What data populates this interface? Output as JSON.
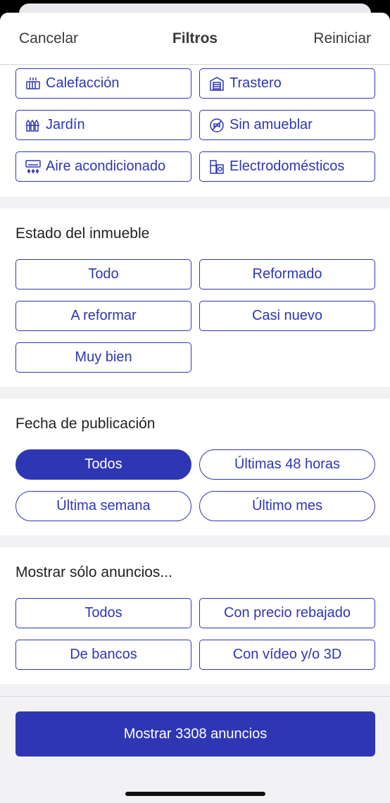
{
  "header": {
    "cancel": "Cancelar",
    "title": "Filtros",
    "reset": "Reiniciar"
  },
  "amenities": [
    {
      "label": "Calefacción",
      "icon": "heating-icon"
    },
    {
      "label": "Trastero",
      "icon": "storage-room-icon"
    },
    {
      "label": "Jardín",
      "icon": "garden-icon"
    },
    {
      "label": "Sin amueblar",
      "icon": "unfurnished-icon"
    },
    {
      "label": "Aire acondicionado",
      "icon": "air-conditioning-icon"
    },
    {
      "label": "Electrodomésticos",
      "icon": "appliances-icon"
    }
  ],
  "condition": {
    "title": "Estado del inmueble",
    "options": [
      "Todo",
      "Reformado",
      "A reformar",
      "Casi nuevo",
      "Muy bien"
    ]
  },
  "publication": {
    "title": "Fecha de publicación",
    "options": [
      "Todos",
      "Últimas 48 horas",
      "Última semana",
      "Último mes"
    ],
    "selected": "Todos"
  },
  "only_show": {
    "title": "Mostrar sólo anuncios...",
    "options": [
      "Todos",
      "Con precio rebajado",
      "De bancos",
      "Con vídeo y/o 3D"
    ]
  },
  "footer": {
    "cta": "Mostrar 3308 anuncios"
  },
  "colors": {
    "accent": "#2f36b4",
    "background": "#f2f2f4"
  }
}
